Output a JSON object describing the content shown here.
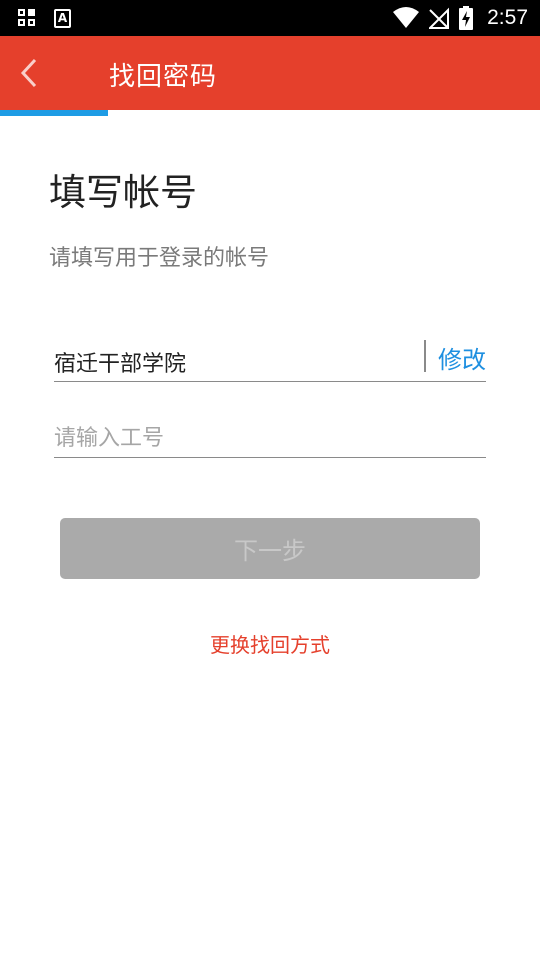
{
  "status_bar": {
    "time": "2:57",
    "left_icons": [
      "grid-icon",
      "a-badge-icon"
    ],
    "right_icons": [
      "wifi-icon",
      "no-signal-icon",
      "battery-charging-icon"
    ]
  },
  "app_bar": {
    "title": "找回密码",
    "back_icon": "chevron-left-icon",
    "color": "#e5402c"
  },
  "progress": {
    "step": 1,
    "fraction": 0.2,
    "color": "#1e9ce5"
  },
  "main": {
    "heading": "填写帐号",
    "subheading": "请填写用于登录的帐号",
    "school_field": {
      "value": "宿迁干部学院",
      "modify_label": "修改",
      "link_color": "#1e8fe0"
    },
    "id_field": {
      "value": "",
      "placeholder": "请输入工号"
    },
    "next_button_label": "下一步",
    "switch_method_label": "更换找回方式"
  }
}
